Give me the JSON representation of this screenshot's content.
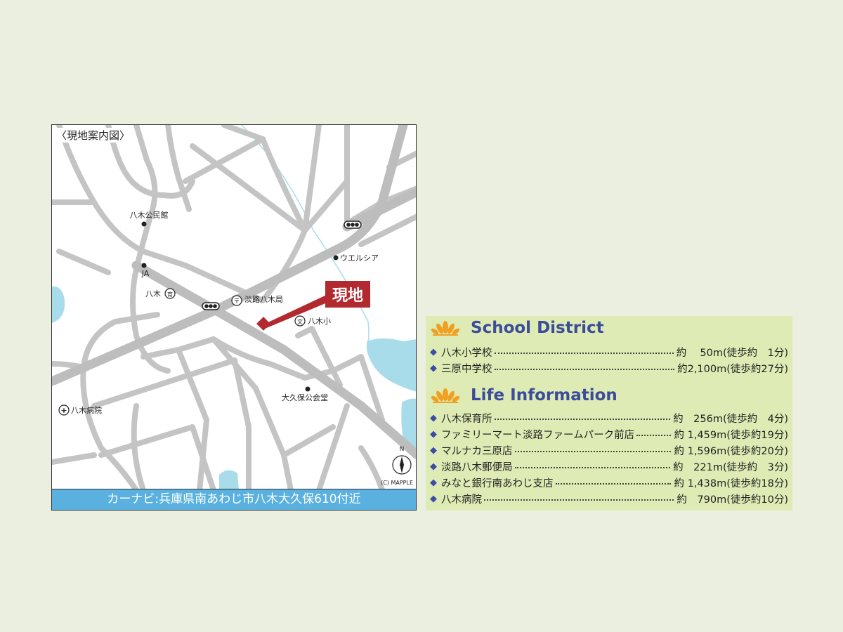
{
  "map": {
    "title": "〈現地案内図〉",
    "navi": "カーナビ:兵庫県南あわじ市八木大久保610付近",
    "site_label": "現地",
    "landmarks": {
      "kominkan": "八木公民館",
      "ja": "JA",
      "yagi_nursery": "八木",
      "post_office": "淡路八木局",
      "welcia": "ウエルシア",
      "yagi_elementary": "八木小",
      "okubo_hall": "大久保公会堂",
      "yagi_hospital": "八木病院"
    },
    "icons": {
      "nursery_icon_char": "育",
      "school_icon_char": "文",
      "post_icon_char": "〒",
      "hospital_icon_char": "+"
    },
    "compass_n": "N",
    "copyright": "(C) MAPPLE",
    "colors": {
      "road": "#c4c4c4",
      "water": "#a9dcea",
      "site": "#b22a30",
      "navi_bar": "#5ab1e0"
    }
  },
  "info": {
    "school": {
      "heading": "School District",
      "items": [
        {
          "name": "八木小学校",
          "dist": "約　 50m(徒歩約　1分)"
        },
        {
          "name": "三原中学校",
          "dist": "約2,100m(徒歩約27分)"
        }
      ]
    },
    "life": {
      "heading": "Life Information",
      "items": [
        {
          "name": "八木保育所",
          "dist": "約　256m(徒歩約　4分)"
        },
        {
          "name": "ファミリーマート淡路ファームパーク前店",
          "dist": "約 1,459m(徒歩約19分)"
        },
        {
          "name": "マルナカ三原店",
          "dist": "約 1,596m(徒歩約20分)"
        },
        {
          "name": "淡路八木郵便局",
          "dist": "約　221m(徒歩約　3分)"
        },
        {
          "name": "みなと銀行南あわじ支店",
          "dist": "約 1,438m(徒歩約18分)"
        },
        {
          "name": "八木病院",
          "dist": "約　790m(徒歩約10分)"
        }
      ]
    },
    "colors": {
      "panel_bg": "#dfebb4",
      "heading": "#3c4c9c",
      "bullet": "#3a4ea8",
      "lotus": "#f0a020"
    }
  }
}
